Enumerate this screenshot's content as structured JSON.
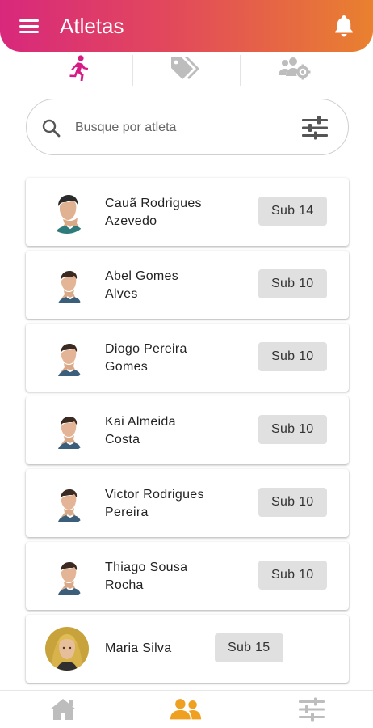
{
  "header": {
    "title": "Atletas",
    "menu_icon": "menu-icon",
    "bell_icon": "bell-icon"
  },
  "tabs": [
    {
      "icon": "running-icon",
      "active": true
    },
    {
      "icon": "tags-icon",
      "active": false
    },
    {
      "icon": "users-cog-icon",
      "active": false
    }
  ],
  "search": {
    "placeholder": "Busque por atleta",
    "value": "",
    "filter_icon": "sliders-icon"
  },
  "athletes": [
    {
      "name_line1": "Cauã Rodrigues",
      "name_line2": "Azevedo",
      "category": "Sub 14"
    },
    {
      "name_line1": "Abel Gomes",
      "name_line2": "Alves",
      "category": "Sub 10"
    },
    {
      "name_line1": "Diogo Pereira",
      "name_line2": "Gomes",
      "category": "Sub 10"
    },
    {
      "name_line1": "Kai Almeida",
      "name_line2": "Costa",
      "category": "Sub 10"
    },
    {
      "name_line1": "Victor Rodrigues",
      "name_line2": "Pereira",
      "category": "Sub 10"
    },
    {
      "name_line1": "Thiago Sousa",
      "name_line2": "Rocha",
      "category": "Sub 10"
    },
    {
      "name_line1": "Maria Silva",
      "name_line2": "",
      "category": "Sub 15"
    }
  ],
  "bottom_nav": [
    {
      "icon": "home-icon",
      "active": false
    },
    {
      "icon": "users-icon",
      "active": true
    },
    {
      "icon": "sliders-icon",
      "active": false
    }
  ],
  "colors": {
    "gradient_start": "#d8287c",
    "gradient_end": "#e9812f",
    "active_tab": "#d81b84",
    "active_nav": "#f0a020",
    "inactive_icon": "#bdbdbd",
    "badge_bg": "#e0e0e0"
  }
}
